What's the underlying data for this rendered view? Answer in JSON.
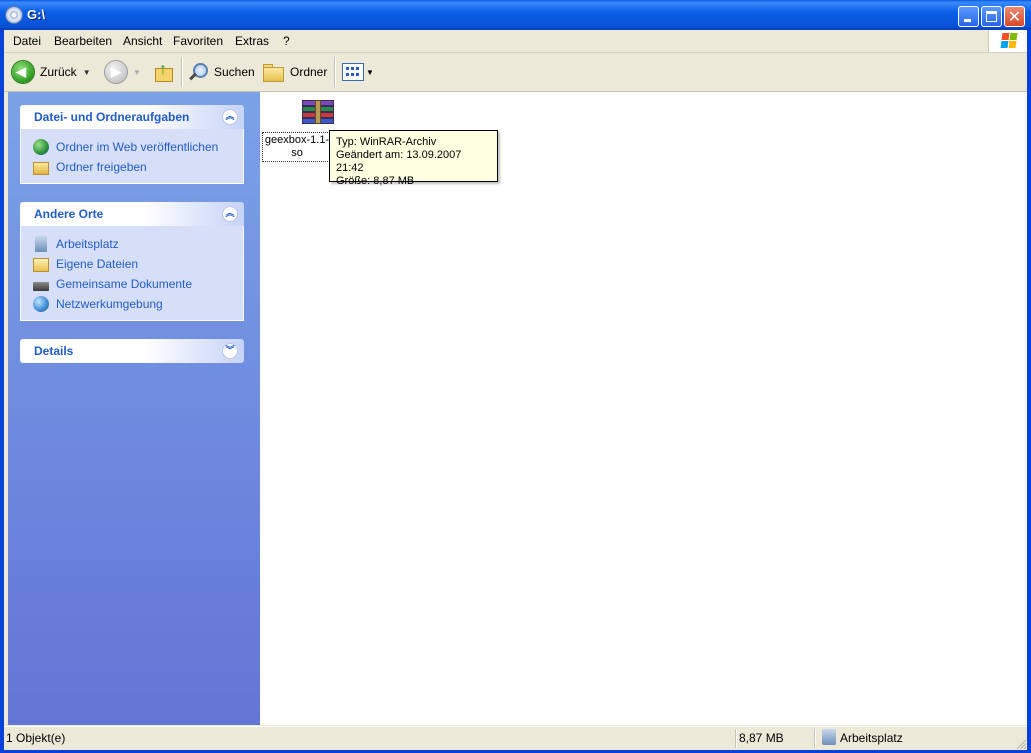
{
  "window": {
    "title": "G:\\"
  },
  "menu": {
    "items": [
      "Datei",
      "Bearbeiten",
      "Ansicht",
      "Favoriten",
      "Extras",
      "?"
    ]
  },
  "toolbar": {
    "back": "Zurück",
    "search": "Suchen",
    "folders": "Ordner"
  },
  "tasks": {
    "file_tasks": {
      "title": "Datei- und Ordneraufgaben",
      "links": [
        "Ordner im Web veröffentlichen",
        "Ordner freigeben"
      ]
    },
    "other_places": {
      "title": "Andere Orte",
      "links": [
        "Arbeitsplatz",
        "Eigene Dateien",
        "Gemeinsame Dokumente",
        "Netzwerkumgebung"
      ]
    },
    "details": {
      "title": "Details"
    }
  },
  "file": {
    "label_line1": "geexbox-1.1-",
    "label_line2": "so",
    "icon": "winrar-archive-icon"
  },
  "tooltip": {
    "type": "Typ: WinRAR-Archiv",
    "modified": "Geändert am: 13.09.2007 21:42",
    "size": "Größe: 8,87 MB"
  },
  "status": {
    "objects": "1 Objekt(e)",
    "size": "8,87 MB",
    "location": "Arbeitsplatz"
  },
  "colors": {
    "title_bar": "#0652d6",
    "task_pane": "#6d8ae0",
    "link": "#215dc6",
    "tooltip_bg": "#ffffe1"
  }
}
